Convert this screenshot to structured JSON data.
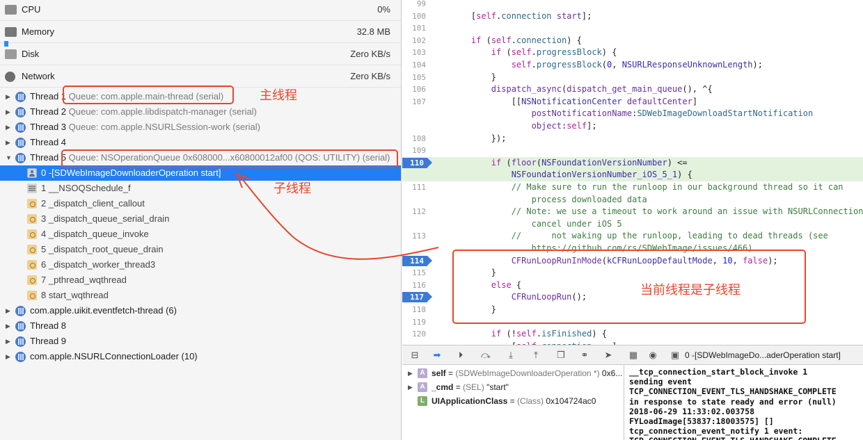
{
  "gauges": [
    {
      "label": "CPU",
      "value": "0%",
      "icon": "cpu-gauge-icon"
    },
    {
      "label": "Memory",
      "value": "32.8 MB",
      "icon": "memory-gauge-icon"
    },
    {
      "label": "Disk",
      "value": "Zero KB/s",
      "icon": "disk-gauge-icon"
    },
    {
      "label": "Network",
      "value": "Zero KB/s",
      "icon": "network-gauge-icon"
    }
  ],
  "threads": [
    {
      "name": "Thread 1",
      "queue": "Queue: com.apple.main-thread (serial)"
    },
    {
      "name": "Thread 2",
      "queue": "Queue: com.apple.libdispatch-manager (serial)"
    },
    {
      "name": "Thread 3",
      "queue": "Queue: com.apple.NSURLSession-work (serial)"
    },
    {
      "name": "Thread 4",
      "queue": ""
    },
    {
      "name": "Thread 5",
      "queue": "Queue: NSOperationQueue 0x608000...x60800012af00 (QOS: UTILITY) (serial)"
    }
  ],
  "frames": [
    "0 -[SDWebImageDownloaderOperation start]",
    "1 __NSOQSchedule_f",
    "2 _dispatch_client_callout",
    "3 _dispatch_queue_serial_drain",
    "4 _dispatch_queue_invoke",
    "5 _dispatch_root_queue_drain",
    "6 _dispatch_worker_thread3",
    "7 _pthread_wqthread",
    "8 start_wqthread"
  ],
  "more_threads": [
    "com.apple.uikit.eventfetch-thread (6)",
    "Thread 8",
    "Thread 9",
    "com.apple.NSURLConnectionLoader (10)"
  ],
  "code_lines": [
    {
      "n": "99",
      "html": ""
    },
    {
      "n": "100",
      "html": "    [<span class='k'>self</span>.<span class='t'>connection</span> <span class='m'>start</span>];"
    },
    {
      "n": "101",
      "html": ""
    },
    {
      "n": "102",
      "html": "    <span class='k'>if</span> (<span class='k'>self</span>.<span class='t'>connection</span>) {"
    },
    {
      "n": "103",
      "html": "        <span class='k'>if</span> (<span class='k'>self</span>.<span class='t'>progressBlock</span>) {"
    },
    {
      "n": "104",
      "html": "            <span class='k'>self</span>.<span class='t'>progressBlock</span>(<span class='n'>0</span>, <span class='s'>NSURLResponseUnknownLength</span>);"
    },
    {
      "n": "105",
      "html": "        }"
    },
    {
      "n": "106",
      "html": "        <span class='m'>dispatch_async</span>(<span class='m'>dispatch_get_main_queue</span>(), ^{"
    },
    {
      "n": "107",
      "html": "            [[<span class='s'>NSNotificationCenter</span> <span class='m'>defaultCenter</span>]"
    },
    {
      "n": "",
      "html": "                <span class='m'>postNotificationName</span>:<span class='t'>SDWebImageDownloadStartNotification</span>"
    },
    {
      "n": "",
      "html": "                <span class='m'>object</span>:<span class='k'>self</span>];"
    },
    {
      "n": "108",
      "html": "        });"
    },
    {
      "n": "109",
      "html": ""
    },
    {
      "n": "110",
      "html": "        <span class='k'>if</span> (<span class='m'>floor</span>(<span class='s'>NSFoundationVersionNumber</span>) &lt;=",
      "bp": true,
      "hl": true
    },
    {
      "n": "",
      "html": "            <span class='s'>NSFoundationVersionNumber_iOS_5_1</span>) {",
      "hl": true
    },
    {
      "n": "111",
      "html": "            <span class='c'>// Make sure to run the runloop in our background thread so it can</span>"
    },
    {
      "n": "",
      "html": "                <span class='c'>process downloaded data</span>"
    },
    {
      "n": "112",
      "html": "            <span class='c'>// Note: we use a timeout to work around an issue with NSURLConnection</span>"
    },
    {
      "n": "",
      "html": "                <span class='c'>cancel under iOS 5</span>"
    },
    {
      "n": "113",
      "html": "            <span class='c'>//      not waking up the runloop, leading to dead threads (see</span>"
    },
    {
      "n": "",
      "html": "                <span class='c'>https://github.com/rs/SDWebImage/issues/466)</span>"
    },
    {
      "n": "114",
      "html": "            <span class='m'>CFRunLoopRunInMode</span>(<span class='s'>kCFRunLoopDefaultMode</span>, <span class='n'>10</span>, <span class='k'>false</span>);",
      "bp": true
    },
    {
      "n": "115",
      "html": "        }"
    },
    {
      "n": "116",
      "html": "        <span class='k'>else</span> {"
    },
    {
      "n": "117",
      "html": "            <span class='m'>CFRunLoopRun</span>();",
      "bp": true
    },
    {
      "n": "118",
      "html": "        }"
    },
    {
      "n": "119",
      "html": ""
    },
    {
      "n": "120",
      "html": "        <span class='k'>if</span> (!<span class='k'>self</span>.<span class='t'>isFinished</span>) {"
    },
    {
      "n": "",
      "html": "            [<span class='k'>self</span>.<span class='t'>connection</span> <span class='m'>...</span>]"
    }
  ],
  "crumb": "0 -[SDWebImageDo...aderOperation start]",
  "vars": [
    {
      "badge": "A",
      "name": "self",
      "type": "(SDWebImageDownloaderOperation *)",
      "value": "0x6...",
      "tri": true
    },
    {
      "badge": "A",
      "name": "_cmd",
      "type": "(SEL)",
      "value": "\"start\"",
      "tri": true
    },
    {
      "badge": "L",
      "name": "UIApplicationClass",
      "type": "(Class)",
      "value": "0x104724ac0",
      "tri": false
    }
  ],
  "console": [
    "__tcp_connection_start_block_invoke 1",
    "sending event",
    "TCP_CONNECTION_EVENT_TLS_HANDSHAKE_COMPLETE",
    "in response to state ready and error (null)",
    "2018-06-29 11:33:02.003758",
    "FYLoadImage[53837:18003575] []",
    "tcp_connection_event_notify 1 event:",
    "TCP_CONNECTION_EVENT_TLS_HANDSHAKE_COMPLETE"
  ],
  "annotations": {
    "main_thread": "主线程",
    "sub_thread": "子线程",
    "current": "当前线程是子线程",
    "color": "#e8462c"
  }
}
